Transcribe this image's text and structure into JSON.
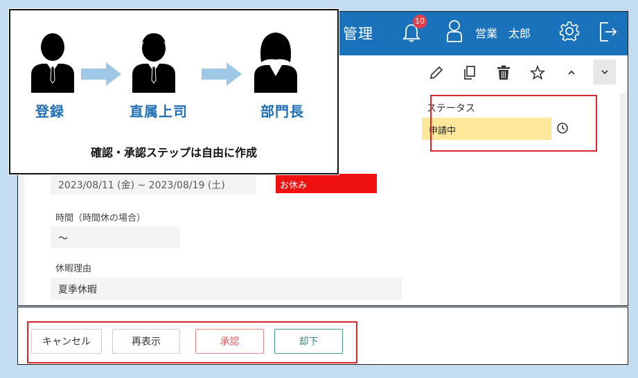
{
  "header": {
    "app_title_fragment": "管理",
    "notification_count": "10",
    "user_name": "営業　太郎"
  },
  "form": {
    "period_value": "2023/08/11 (金) ~ 2023/08/19 (土)",
    "leave_type_value": "お休み",
    "time_label": "時間（時間休の場合）",
    "time_value": "～",
    "reason_label": "休暇理由",
    "reason_value": "夏季休暇",
    "status_label": "ステータス",
    "status_value": "申請中"
  },
  "footer": {
    "cancel_label": "キャンセル",
    "reload_label": "再表示",
    "approve_label": "承認",
    "reject_label": "却下"
  },
  "callout": {
    "roles": [
      "登録",
      "直属上司",
      "部門長"
    ],
    "caption": "確認・承認ステップは自由に作成"
  },
  "colors": {
    "header": "#1a72bb",
    "status_fill": "#fde79a",
    "highlight": "#d9252b",
    "role_text": "#1f6fb4"
  }
}
